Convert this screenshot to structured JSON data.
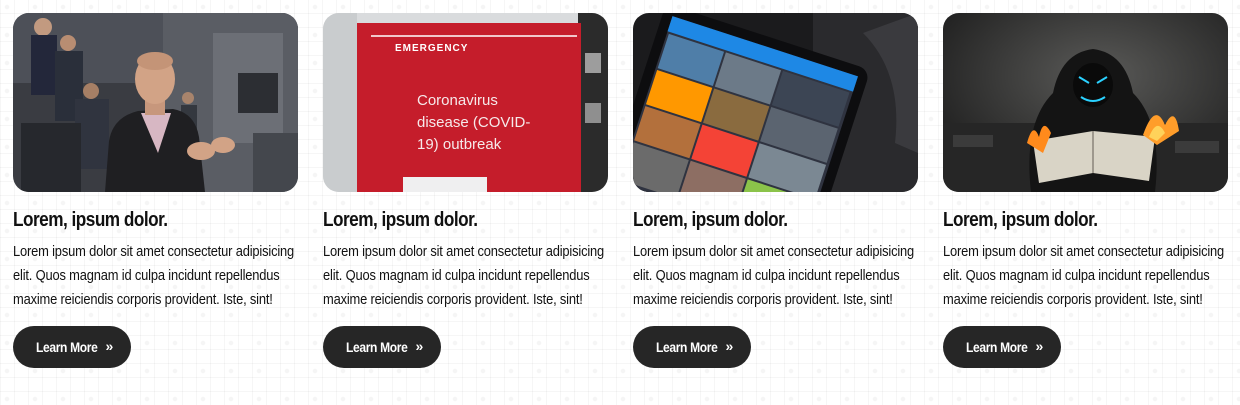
{
  "cards": [
    {
      "image_subject": "presenter-photo",
      "title": "Lorem, ipsum dolor.",
      "text": "Lorem ipsum dolor sit amet consectetur adipisicing elit. Quos magnam id culpa incidunt repellendus maxime reiciendis corporis provident. Iste, sint!",
      "button_label": "Learn More",
      "button_icon": "double-chevron-right-icon"
    },
    {
      "image_subject": "emergency-sign-photo",
      "image_text": {
        "header": "EMERGENCY",
        "line1": "Coronavirus",
        "line2": "disease (COVID-",
        "line3": "19) outbreak"
      },
      "title": "Lorem, ipsum dolor.",
      "text": "Lorem ipsum dolor sit amet consectetur adipisicing elit. Quos magnam id culpa incidunt repellendus maxime reiciendis corporis provident. Iste, sint!",
      "button_label": "Learn More",
      "button_icon": "double-chevron-right-icon"
    },
    {
      "image_subject": "tablet-app-photo",
      "title": "Lorem, ipsum dolor.",
      "text": "Lorem ipsum dolor sit amet consectetur adipisicing elit. Quos magnam id culpa incidunt repellendus maxime reiciendis corporis provident. Iste, sint!",
      "button_label": "Learn More",
      "button_icon": "double-chevron-right-icon"
    },
    {
      "image_subject": "hooded-figure-burning-newspaper-photo",
      "title": "Lorem, ipsum dolor.",
      "text": "Lorem ipsum dolor sit amet consectetur adipisicing elit. Quos magnam id culpa incidunt repellendus maxime reiciendis corporis provident. Iste, sint!",
      "button_label": "Learn More",
      "button_icon": "double-chevron-right-icon"
    }
  ],
  "colors": {
    "button_bg": "#262626",
    "button_text": "#ffffff",
    "title_text": "#111111"
  }
}
